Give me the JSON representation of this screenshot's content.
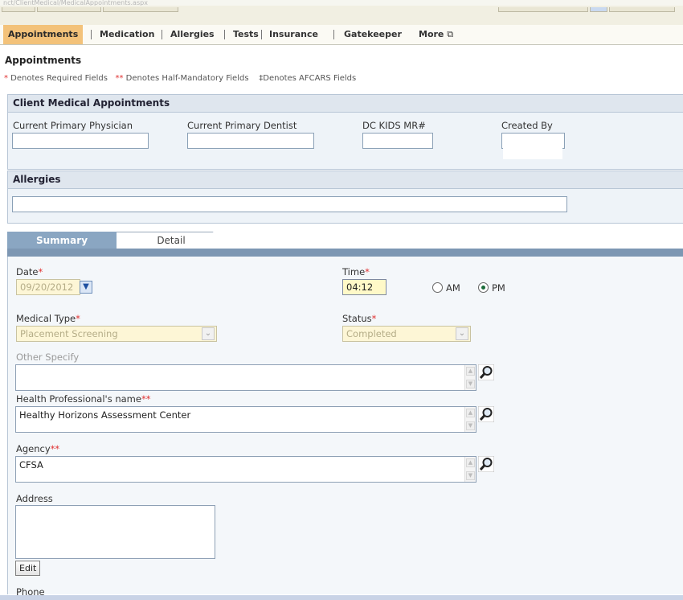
{
  "browser": {
    "url": "nct/ClientMedical/MedicalAppointments.aspx"
  },
  "nav": {
    "items": [
      "Appointments",
      "Medication",
      "Allergies",
      "Tests",
      "Insurance",
      "Gatekeeper",
      "More"
    ],
    "active": "Appointments"
  },
  "page": {
    "title": "Appointments",
    "legend_required_star": "*",
    "legend_required": " Denotes Required Fields",
    "legend_half_star": "**",
    "legend_half": " Denotes Half-Mandatory Fields",
    "legend_afcars_mark": "‡",
    "legend_afcars": "Denotes AFCARS Fields"
  },
  "client_medical": {
    "title": "Client Medical Appointments",
    "physician_label": "Current Primary Physician",
    "dentist_label": "Current Primary Dentist",
    "mr_label": "DC KIDS MR#",
    "created_label": "Created By",
    "physician_value": "",
    "dentist_value": "",
    "mr_value": "",
    "created_value": ""
  },
  "allergies": {
    "title": "Allergies",
    "value": ""
  },
  "tabs": {
    "summary": "Summary",
    "detail": "Detail",
    "active": "Summary"
  },
  "form": {
    "date_label": "Date",
    "date_value": "09/20/2012",
    "time_label": "Time",
    "time_value": "04:12",
    "am_label": "AM",
    "pm_label": "PM",
    "meridiem": "PM",
    "required_mark": "*",
    "half_mark": "**",
    "medical_type_label": "Medical Type",
    "medical_type_value": "Placement Screening",
    "status_label": "Status",
    "status_value": "Completed",
    "other_specify_label": "Other Specify",
    "other_specify_value": "",
    "health_prof_label": "Health Professional's name",
    "health_prof_value": "Healthy Horizons Assessment Center",
    "agency_label": "Agency",
    "agency_value": "CFSA",
    "address_label": "Address",
    "address_value": "",
    "edit_button": "Edit",
    "phone_label": "Phone"
  },
  "colors": {
    "active_tab": "#f3c27a",
    "required": "#e03030",
    "section_header": "#dfe6ee",
    "summary_tab": "#8aa6c2"
  }
}
